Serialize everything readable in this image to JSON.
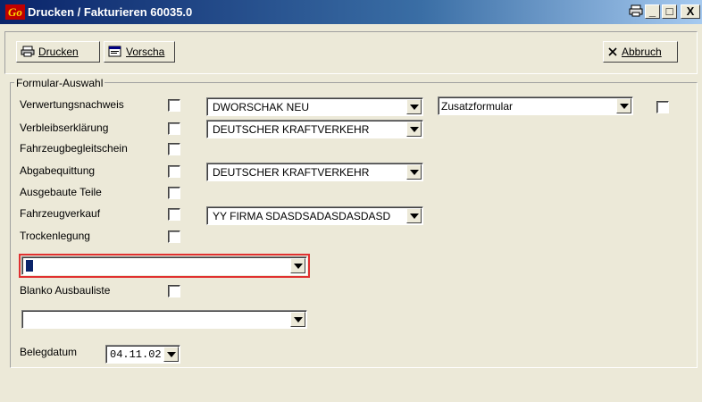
{
  "window": {
    "logo": "Go",
    "title": "Drucken / Fakturieren 60035.0",
    "controls": {
      "minimize": "_",
      "maximize": "□",
      "close": "X"
    }
  },
  "toolbar": {
    "print_label": "Drucken",
    "preview_label": "Vorscha",
    "cancel_label": "Abbruch"
  },
  "form": {
    "group_label": "Formular-Auswahl",
    "rows": [
      {
        "label": "Verwertungsnachweis",
        "checked": false,
        "select": "DWORSCHAK NEU"
      },
      {
        "label": "Verbleibserklärung",
        "checked": false,
        "select": "DEUTSCHER KRAFTVERKEHR"
      },
      {
        "label": "Fahrzeugbegleitschein",
        "checked": false
      },
      {
        "label": "Abgabequittung",
        "checked": false,
        "select": "DEUTSCHER KRAFTVERKEHR"
      },
      {
        "label": "Ausgebaute Teile",
        "checked": false
      },
      {
        "label": "Fahrzeugverkauf",
        "checked": false,
        "select": "YY FIRMA SDASDSADASDASDASD"
      },
      {
        "label": "Trockenlegung",
        "checked": false
      }
    ],
    "extra_form": {
      "select": "Zusatzformular",
      "checked": false
    },
    "focused_select": "",
    "blanko_label": "Blanko Ausbauliste",
    "blanko_checked": false,
    "blanko_select": "",
    "date_label": "Belegdatum",
    "date_value": "04.11.02"
  }
}
